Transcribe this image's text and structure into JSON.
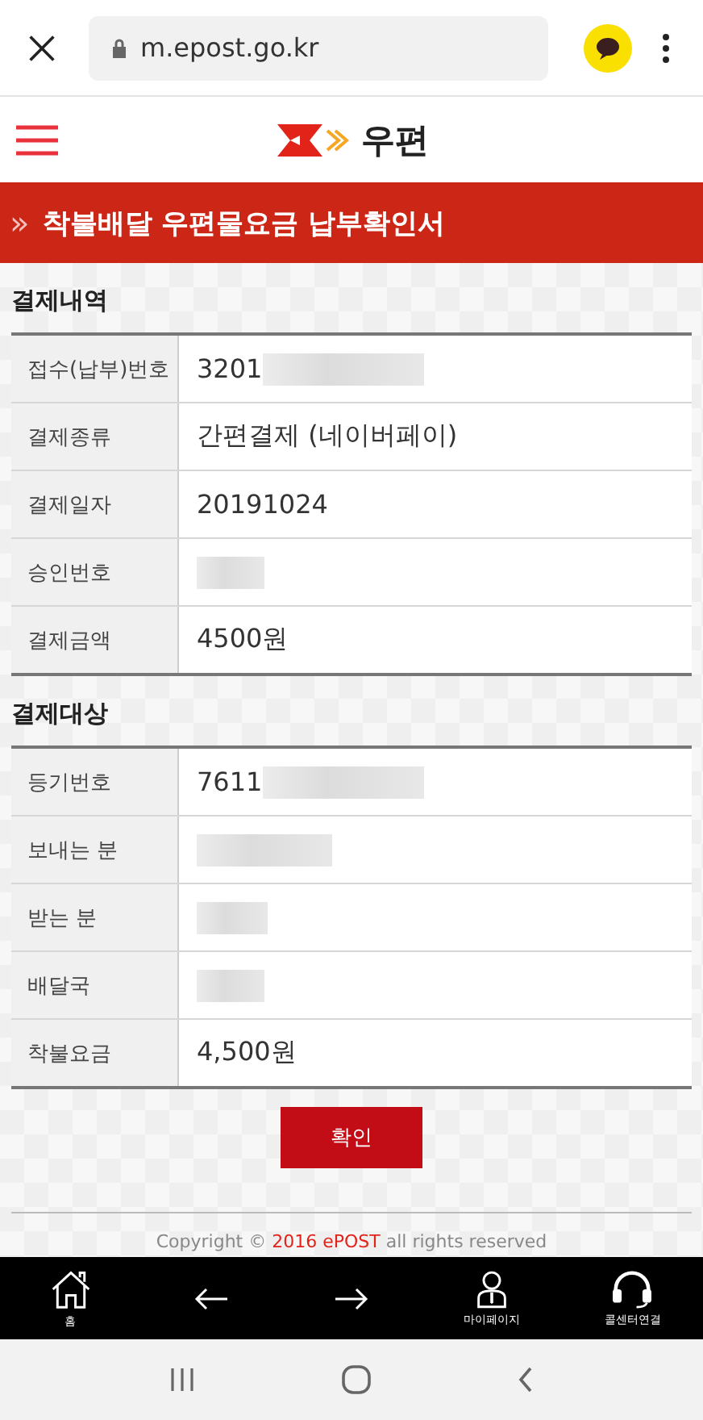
{
  "browser": {
    "url": "m.epost.go.kr"
  },
  "header": {
    "logo_text": "우편"
  },
  "page_title": {
    "arrow": "»",
    "text": "착불배달 우편물요금 납부확인서"
  },
  "sections": [
    {
      "title": "결제내역",
      "rows": [
        {
          "label": "접수(납부)번호",
          "value": "3201",
          "masked": true
        },
        {
          "label": "결제종류",
          "value": "간편결제 (네이버페이)"
        },
        {
          "label": "결제일자",
          "value": "20191024"
        },
        {
          "label": "승인번호",
          "masked": true
        },
        {
          "label": "결제금액",
          "value": "4500원"
        }
      ]
    },
    {
      "title": "결제대상",
      "rows": [
        {
          "label": "등기번호",
          "value": "7611",
          "masked": true
        },
        {
          "label": "보내는 분",
          "masked": true
        },
        {
          "label": "받는 분",
          "masked": true
        },
        {
          "label": "배달국",
          "masked": true
        },
        {
          "label": "착불요금",
          "value": "4,500원"
        }
      ]
    }
  ],
  "confirm_button": "확인",
  "footer": [
    {
      "text": "Copyright © ",
      "highlight": false
    },
    {
      "text": "2016 ePOST",
      "highlight": true
    },
    {
      "text": " all rights reserved",
      "highlight": false
    }
  ],
  "bottom_nav": [
    {
      "kind": "home",
      "label": "홈"
    },
    {
      "kind": "back"
    },
    {
      "kind": "forward"
    },
    {
      "kind": "person",
      "label": "마이페이지"
    },
    {
      "kind": "headset",
      "label": "콜센터연결"
    }
  ]
}
